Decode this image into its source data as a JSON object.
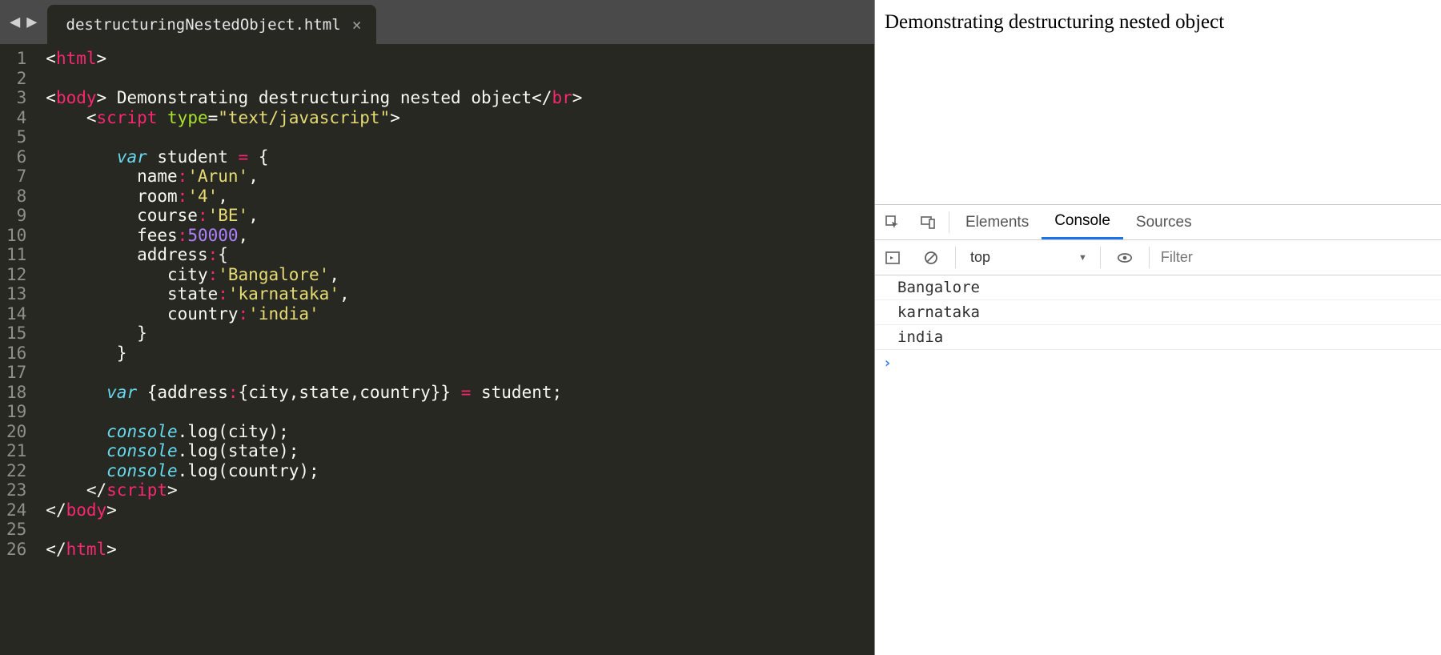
{
  "editor": {
    "tab": {
      "filename": "destructuringNestedObject.html"
    },
    "line_count": 26,
    "code_lines": [
      [
        [
          "p",
          "<"
        ],
        [
          "tg",
          "html"
        ],
        [
          "p",
          ">"
        ]
      ],
      [],
      [
        [
          "p",
          "<"
        ],
        [
          "tg",
          "body"
        ],
        [
          "p",
          "> Demonstrating destructuring nested object</"
        ],
        [
          "tg",
          "br"
        ],
        [
          "p",
          ">"
        ]
      ],
      [
        [
          "p",
          "    <"
        ],
        [
          "tg",
          "script"
        ],
        [
          "p",
          " "
        ],
        [
          "at",
          "type"
        ],
        [
          "p",
          "="
        ],
        [
          "st",
          "\"text/javascript\""
        ],
        [
          "p",
          ">"
        ]
      ],
      [],
      [
        [
          "p",
          "       "
        ],
        [
          "kw",
          "var"
        ],
        [
          "p",
          " student "
        ],
        [
          "op",
          "="
        ],
        [
          "p",
          " {"
        ]
      ],
      [
        [
          "p",
          "         name"
        ],
        [
          "op",
          ":"
        ],
        [
          "st",
          "'Arun'"
        ],
        [
          "p",
          ","
        ]
      ],
      [
        [
          "p",
          "         room"
        ],
        [
          "op",
          ":"
        ],
        [
          "st",
          "'4'"
        ],
        [
          "p",
          ","
        ]
      ],
      [
        [
          "p",
          "         course"
        ],
        [
          "op",
          ":"
        ],
        [
          "st",
          "'BE'"
        ],
        [
          "p",
          ","
        ]
      ],
      [
        [
          "p",
          "         fees"
        ],
        [
          "op",
          ":"
        ],
        [
          "nm",
          "50000"
        ],
        [
          "p",
          ","
        ]
      ],
      [
        [
          "p",
          "         address"
        ],
        [
          "op",
          ":"
        ],
        [
          "p",
          "{"
        ]
      ],
      [
        [
          "p",
          "            city"
        ],
        [
          "op",
          ":"
        ],
        [
          "st",
          "'Bangalore'"
        ],
        [
          "p",
          ","
        ]
      ],
      [
        [
          "p",
          "            state"
        ],
        [
          "op",
          ":"
        ],
        [
          "st",
          "'karnataka'"
        ],
        [
          "p",
          ","
        ]
      ],
      [
        [
          "p",
          "            country"
        ],
        [
          "op",
          ":"
        ],
        [
          "st",
          "'india'"
        ]
      ],
      [
        [
          "p",
          "         }"
        ]
      ],
      [
        [
          "p",
          "       }"
        ]
      ],
      [],
      [
        [
          "p",
          "      "
        ],
        [
          "kw",
          "var"
        ],
        [
          "p",
          " {address"
        ],
        [
          "op",
          ":"
        ],
        [
          "p",
          "{city,state,country}} "
        ],
        [
          "op",
          "="
        ],
        [
          "p",
          " student;"
        ]
      ],
      [],
      [
        [
          "p",
          "      "
        ],
        [
          "ob",
          "console"
        ],
        [
          "p",
          ".log(city);"
        ]
      ],
      [
        [
          "p",
          "      "
        ],
        [
          "ob",
          "console"
        ],
        [
          "p",
          ".log(state);"
        ]
      ],
      [
        [
          "p",
          "      "
        ],
        [
          "ob",
          "console"
        ],
        [
          "p",
          ".log(country);"
        ]
      ],
      [
        [
          "p",
          "    </"
        ],
        [
          "tg",
          "script"
        ],
        [
          "p",
          ">"
        ]
      ],
      [
        [
          "p",
          "</"
        ],
        [
          "tg",
          "body"
        ],
        [
          "p",
          ">"
        ]
      ],
      [],
      [
        [
          "p",
          "</"
        ],
        [
          "tg",
          "html"
        ],
        [
          "p",
          ">"
        ]
      ]
    ]
  },
  "browser": {
    "page_text": "Demonstrating destructuring nested object"
  },
  "devtools": {
    "tabs": {
      "elements": "Elements",
      "console": "Console",
      "sources": "Sources"
    },
    "context": "top",
    "filter_placeholder": "Filter",
    "console_output": [
      "Bangalore",
      "karnataka",
      "india"
    ]
  }
}
